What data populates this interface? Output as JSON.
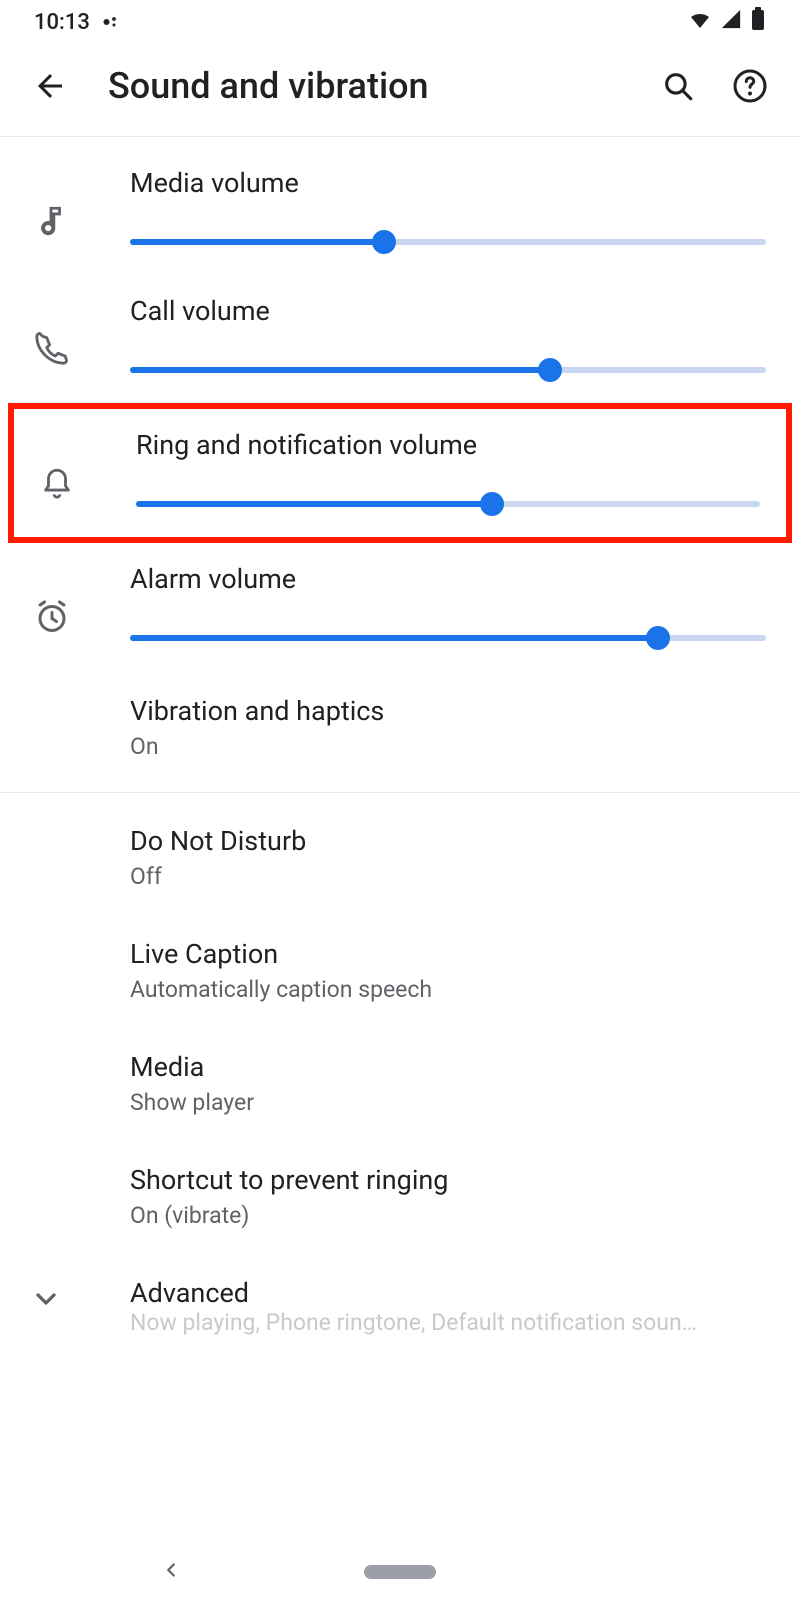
{
  "status": {
    "time": "10:13"
  },
  "header": {
    "title": "Sound and vibration"
  },
  "sliders": {
    "media": {
      "label": "Media volume",
      "value": 40
    },
    "call": {
      "label": "Call volume",
      "value": 66
    },
    "ring": {
      "label": "Ring and notification volume",
      "value": 57
    },
    "alarm": {
      "label": "Alarm volume",
      "value": 83
    }
  },
  "settings": {
    "vibration": {
      "title": "Vibration and haptics",
      "sub": "On"
    },
    "dnd": {
      "title": "Do Not Disturb",
      "sub": "Off"
    },
    "caption": {
      "title": "Live Caption",
      "sub": "Automatically caption speech"
    },
    "media": {
      "title": "Media",
      "sub": "Show player"
    },
    "shortcut": {
      "title": "Shortcut to prevent ringing",
      "sub": "On (vibrate)"
    },
    "advanced": {
      "title": "Advanced",
      "sub": "Now playing, Phone ringtone, Default notification soun…"
    }
  }
}
